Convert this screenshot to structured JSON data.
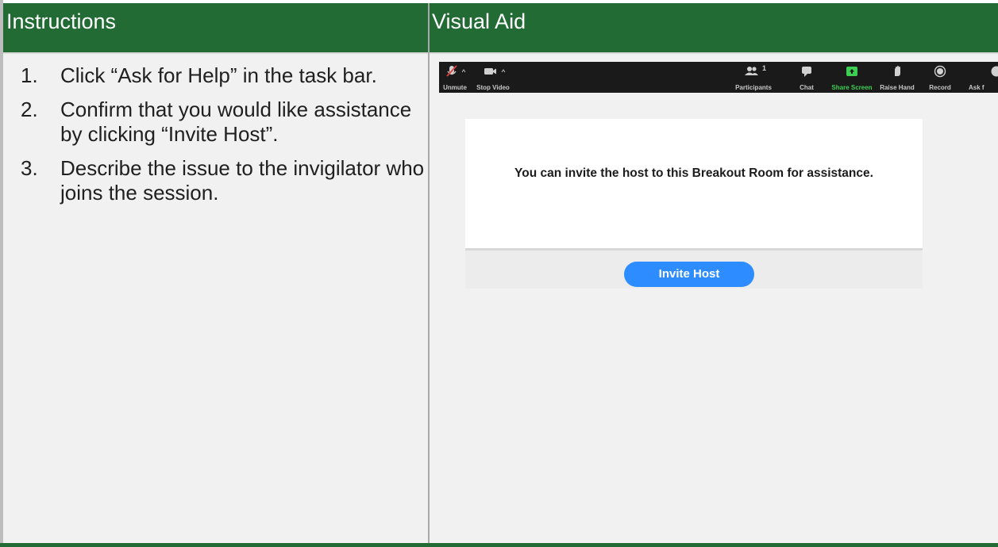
{
  "header": {
    "left_title": "Instructions",
    "right_title": "Visual Aid"
  },
  "instructions": {
    "steps": [
      {
        "num": "1.",
        "text": "Click “Ask for Help” in the task bar."
      },
      {
        "num": "2.",
        "text": "Confirm that you would like assistance by clicking “Invite Host”."
      },
      {
        "num": "3.",
        "text": "Describe the issue to the invigilator who joins the session."
      }
    ]
  },
  "toolbar": {
    "unmute": "Unmute",
    "stop_video": "Stop Video",
    "participants": "Participants",
    "participants_count": "1",
    "chat": "Chat",
    "share_screen": "Share Screen",
    "raise_hand": "Raise Hand",
    "record": "Record",
    "ask_for_help": "Ask f"
  },
  "dialog": {
    "message": "You can invite the host to this Breakout Room for assistance.",
    "button": "Invite Host"
  },
  "colors": {
    "header_green": "#236b35",
    "share_green": "#3ccf53",
    "invite_blue": "#2d8cff",
    "toolbar_dark": "#1a1a1a"
  },
  "icons": [
    "muted-mic-icon",
    "camera-icon",
    "participants-icon",
    "chat-icon",
    "share-screen-icon",
    "raise-hand-icon",
    "record-icon"
  ]
}
